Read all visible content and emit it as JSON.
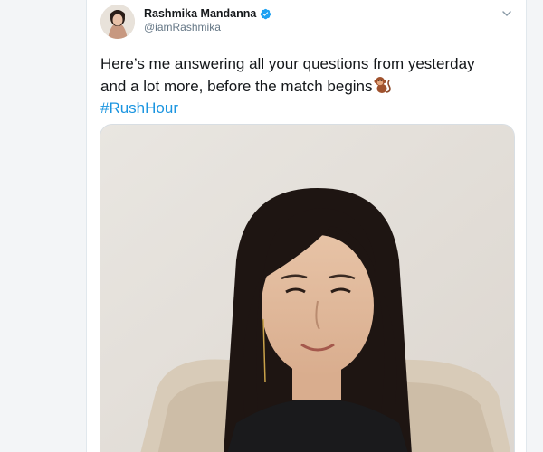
{
  "tweet": {
    "author": {
      "name": "Rashmika Mandanna",
      "handle": "@iamRashmika",
      "verified": true
    },
    "text_line1": "Here’s me answering all your questions from yesterday",
    "text_line2": "and a lot more, before the match begins",
    "emoji": "monkey-emoji",
    "hashtag": "#RushHour",
    "media": {
      "type": "video-frame",
      "description_icon": "video-thumbnail"
    }
  },
  "colors": {
    "verified_badge": "#1da1f2",
    "hashtag": "#1b95e0",
    "handle": "#657786",
    "text": "#14171a"
  }
}
